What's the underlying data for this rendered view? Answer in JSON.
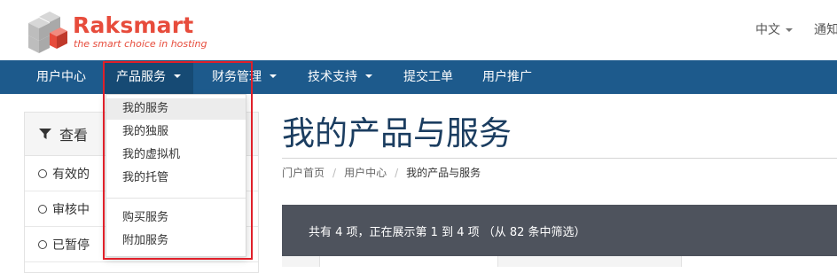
{
  "header": {
    "logo_name": "Raksmart",
    "logo_tagline": "the smart choice in hosting",
    "language_label": "中文",
    "notifications_label": "通知"
  },
  "navbar": {
    "items": [
      {
        "label": "用户中心"
      },
      {
        "label": "产品服务",
        "active": true,
        "has_dropdown": true
      },
      {
        "label": "财务管理",
        "has_dropdown": true
      },
      {
        "label": "技术支持",
        "has_dropdown": true
      },
      {
        "label": "提交工单"
      },
      {
        "label": "用户推广"
      }
    ]
  },
  "dropdown": {
    "items": [
      "我的服务",
      "我的独服",
      "我的虚拟机",
      "我的托管",
      "购买服务",
      "附加服务"
    ],
    "hovered": "我的服务"
  },
  "sidebar": {
    "title": "查看",
    "filters": [
      "有效的",
      "审核中",
      "已暂停"
    ]
  },
  "main": {
    "title": "我的产品与服务",
    "breadcrumb": [
      "门户首页",
      "用户中心",
      "我的产品与服务"
    ],
    "info_text": "共有 4 项，正在展示第 1 到 4 项 （从 82 条中筛选）"
  },
  "colors": {
    "brand_red": "#e74c3c",
    "navbar_blue": "#1d5a8c",
    "highlight_red": "#e0202a",
    "info_bar": "#4e535d"
  }
}
